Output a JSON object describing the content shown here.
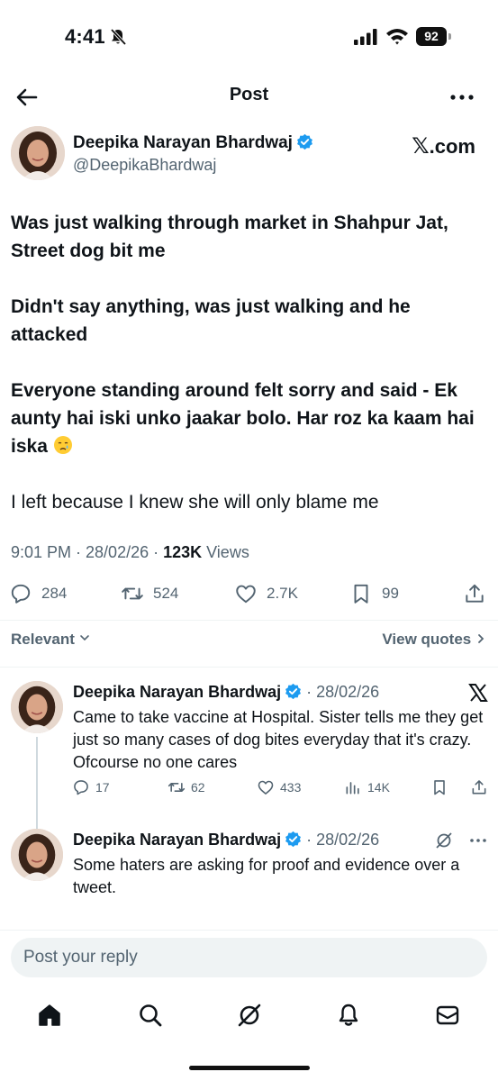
{
  "status_bar": {
    "time": "4:41",
    "battery": "92"
  },
  "header": {
    "title": "Post"
  },
  "post": {
    "author_name": "Deepika Narayan Bhardwaj",
    "handle": "@DeepikaBhardwaj",
    "source_label": ".com",
    "paragraphs": [
      "Was just walking through market in Shahpur Jat, Street dog bit me",
      "Didn't say anything, was just walking and he attacked",
      "Everyone standing around felt sorry and said - Ek aunty hai iski unko jaakar bolo. Har roz ka kaam hai iska",
      "I left because I knew she will only blame me"
    ],
    "time": "9:01 PM · 28/02/26 · ",
    "views": "123K",
    "views_label": " Views",
    "stats": {
      "replies": "284",
      "reposts": "524",
      "likes": "2.7K",
      "bookmarks": "99"
    }
  },
  "sort": {
    "relevant": "Relevant",
    "view_quotes": "View quotes"
  },
  "replies": [
    {
      "author_name": "Deepika Narayan Bhardwaj",
      "date": " · 28/02/26",
      "text": "Came to take vaccine at Hospital. Sister tells me they get just so many cases of dog bites everyday that it's crazy. Ofcourse no one cares",
      "stats": {
        "replies": "17",
        "reposts": "62",
        "likes": "433",
        "views": "14K"
      }
    },
    {
      "author_name": "Deepika Narayan Bhardwaj",
      "date": " · 28/02/26",
      "text": "Some haters are asking for proof and evidence over a tweet."
    }
  ],
  "composer": {
    "placeholder": "Post your reply"
  },
  "colors": {
    "verified": "#1d9bf0",
    "secondary_text": "#536471",
    "divider": "#eff3f4"
  }
}
